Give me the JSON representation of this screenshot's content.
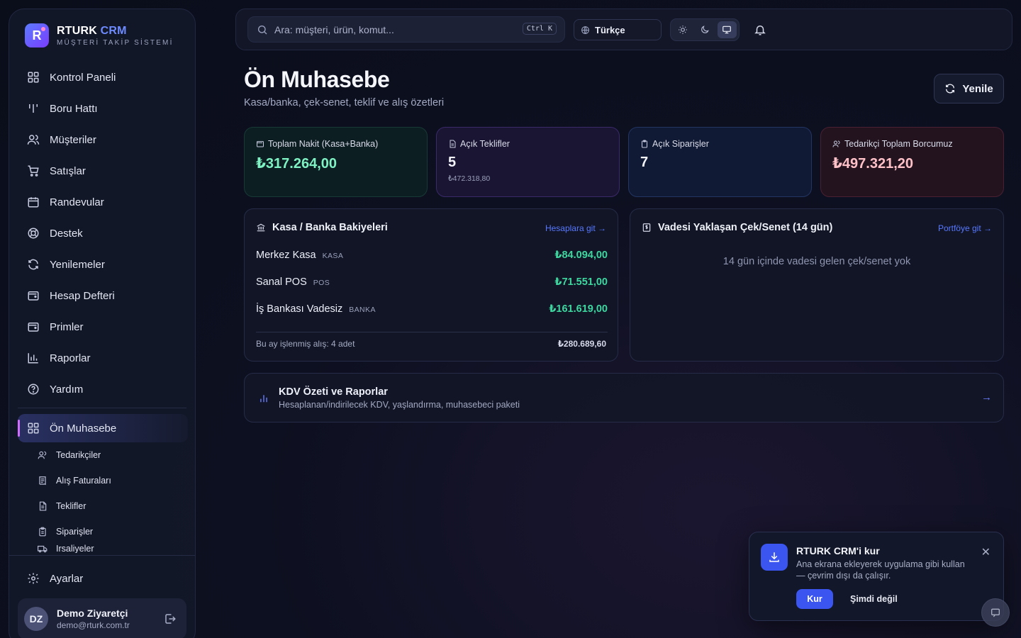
{
  "brand": {
    "name": "RTURK",
    "name_accent": "CRM",
    "subtitle": "MÜŞTERİ TAKİP SİSTEMİ",
    "logo_letter": "R"
  },
  "sidebar": {
    "items": [
      {
        "label": "Kontrol Paneli",
        "icon": "dashboard-icon"
      },
      {
        "label": "Boru Hattı",
        "icon": "pipeline-icon"
      },
      {
        "label": "Müşteriler",
        "icon": "users-icon"
      },
      {
        "label": "Satışlar",
        "icon": "cart-icon"
      },
      {
        "label": "Randevular",
        "icon": "calendar-icon"
      },
      {
        "label": "Destek",
        "icon": "lifebuoy-icon"
      },
      {
        "label": "Yenilemeler",
        "icon": "refresh-icon"
      },
      {
        "label": "Hesap Defteri",
        "icon": "wallet-icon"
      },
      {
        "label": "Primler",
        "icon": "wallet-icon"
      },
      {
        "label": "Raporlar",
        "icon": "bar-chart-icon"
      },
      {
        "label": "Yardım",
        "icon": "help-icon"
      }
    ],
    "active": {
      "label": "Ön Muhasebe",
      "icon": "dashboard-icon"
    },
    "sub_items": [
      {
        "label": "Tedarikçiler",
        "icon": "users-icon"
      },
      {
        "label": "Alış Faturaları",
        "icon": "receipt-icon"
      },
      {
        "label": "Teklifler",
        "icon": "document-icon"
      },
      {
        "label": "Siparişler",
        "icon": "clipboard-icon"
      },
      {
        "label": "İrsaliyeler",
        "icon": "truck-icon"
      }
    ],
    "settings_label": "Ayarlar",
    "user": {
      "initials": "DZ",
      "name": "Demo Ziyaretçi",
      "email": "demo@rturk.com.tr"
    }
  },
  "topbar": {
    "search_placeholder": "Ara: müşteri, ürün, komut...",
    "shortcut": "Ctrl K",
    "language": "Türkçe",
    "theme_selected": "system"
  },
  "header": {
    "title": "Ön Muhasebe",
    "subtitle": "Kasa/banka, çek-senet, teklif ve alış özetleri",
    "refresh_label": "Yenile"
  },
  "stats": [
    {
      "label": "Toplam Nakit (Kasa+Banka)",
      "value": "₺317.264,00",
      "sub": ""
    },
    {
      "label": "Açık Teklifler",
      "value": "5",
      "sub": "₺472.318,80"
    },
    {
      "label": "Açık Siparişler",
      "value": "7",
      "sub": ""
    },
    {
      "label": "Tedarikçi Toplam Borcumuz",
      "value": "₺497.321,20",
      "sub": ""
    }
  ],
  "balances": {
    "title": "Kasa / Banka Bakiyeleri",
    "link": "Hesaplara git →",
    "accounts": [
      {
        "name": "Merkez Kasa",
        "type": "KASA",
        "amount": "₺84.094,00"
      },
      {
        "name": "Sanal POS",
        "type": "POS",
        "amount": "₺71.551,00"
      },
      {
        "name": "İş Bankası Vadesiz",
        "type": "BANKA",
        "amount": "₺161.619,00"
      }
    ],
    "footer_left": "Bu ay işlenmiş alış: 4 adet",
    "footer_right": "₺280.689,60"
  },
  "cheques": {
    "title": "Vadesi Yaklaşan Çek/Senet (14 gün)",
    "link": "Portföye git →",
    "empty": "14 gün içinde vadesi gelen çek/senet yok"
  },
  "kdv": {
    "title": "KDV Özeti ve Raporlar",
    "desc": "Hesaplanan/indirilecek KDV, yaşlandırma, muhasebeci paketi",
    "arrow": "→"
  },
  "install": {
    "title": "RTURK CRM'i kur",
    "desc": "Ana ekrana ekleyerek uygulama gibi kullan — çevrim dışı da çalışır.",
    "install_label": "Kur",
    "later_label": "Şimdi değil",
    "close": "✕"
  },
  "colors": {
    "accent": "#3b55f0",
    "positive": "#3fd7a0",
    "cash": "#7ff2c4",
    "debt": "#ffc1c8"
  }
}
